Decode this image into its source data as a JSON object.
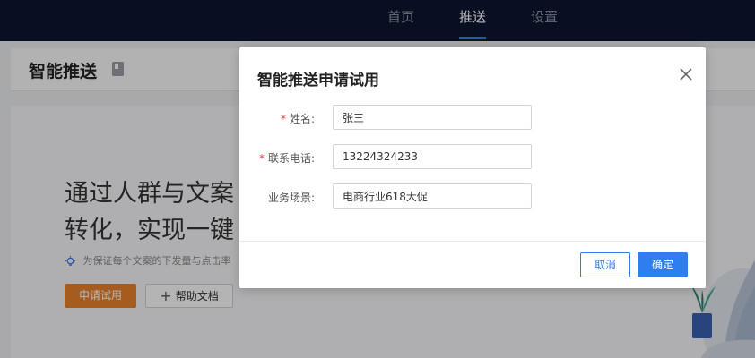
{
  "top_nav": {
    "items": [
      {
        "label": "首页",
        "active": false
      },
      {
        "label": "推送",
        "active": true
      },
      {
        "label": "设置",
        "active": false
      }
    ]
  },
  "page_header": {
    "title": "智能推送",
    "icon": "document-icon"
  },
  "content": {
    "hero_line1": "通过人群与文案",
    "hero_line2": "转化，实现一键",
    "hint_text": "为保证每个文案的下发量与点击率",
    "hint_icon": "lightbulb-icon",
    "trial_button": "申请试用",
    "help_button": "帮助文档"
  },
  "dialog": {
    "title": "智能推送申请试用",
    "close_icon": "close-icon",
    "fields": [
      {
        "label": "姓名:",
        "required": true,
        "value": "张三"
      },
      {
        "label": "联系电话:",
        "required": true,
        "value": "13224324233"
      },
      {
        "label": "业务场景:",
        "required": false,
        "value": "电商行业618大促"
      }
    ],
    "required_mark": "*",
    "cancel_button": "取消",
    "ok_button": "确定"
  },
  "colors": {
    "topbar_bg": "#0d1630",
    "accent_blue": "#2f7ef0",
    "accent_orange": "#e77f2b",
    "required_red": "#e4393c"
  }
}
